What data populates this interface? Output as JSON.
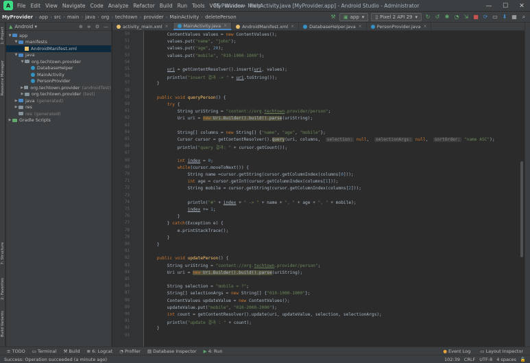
{
  "menu": [
    "File",
    "Edit",
    "View",
    "Navigate",
    "Code",
    "Analyze",
    "Refactor",
    "Build",
    "Run",
    "Tools",
    "VCS",
    "Window",
    "Help"
  ],
  "window_title": "MyProvider - MainActivity.java [MyProvider.app] - Android Studio - Administrator",
  "breadcrumb": [
    "MyProvider",
    "app",
    "src",
    "main",
    "java",
    "org",
    "techtown",
    "provider",
    "MainActivity",
    "deletePerson"
  ],
  "run_config": "app",
  "device": "Pixel 2 API 29",
  "project_view": "Android",
  "left_tools": [
    "1: Project",
    "Resource Manager",
    "7: Structure",
    "2: Favorites",
    "Build Variants"
  ],
  "tree": [
    {
      "label": "app",
      "indent": 0,
      "type": "folder-blue",
      "arrow": "▼"
    },
    {
      "label": "manifests",
      "indent": 1,
      "type": "folder-blue",
      "arrow": "▼"
    },
    {
      "label": "AndroidManifest.xml",
      "indent": 2,
      "type": "xml",
      "arrow": "",
      "selected": true
    },
    {
      "label": "java",
      "indent": 1,
      "type": "folder-blue",
      "arrow": "▼"
    },
    {
      "label": "org.techtown.provider",
      "indent": 2,
      "type": "folder",
      "arrow": "▼"
    },
    {
      "label": "DatabaseHelper",
      "indent": 3,
      "type": "class",
      "arrow": ""
    },
    {
      "label": "MainActivity",
      "indent": 3,
      "type": "class",
      "arrow": ""
    },
    {
      "label": "PersonProvider",
      "indent": 3,
      "type": "class",
      "arrow": ""
    },
    {
      "label": "org.techtown.provider",
      "suffix": "(androidTest)",
      "indent": 2,
      "type": "folder",
      "arrow": "▶"
    },
    {
      "label": "org.techtown.provider",
      "suffix": "(test)",
      "indent": 2,
      "type": "folder",
      "arrow": "▶"
    },
    {
      "label": "java",
      "suffix": "(generated)",
      "indent": 1,
      "type": "folder-blue",
      "arrow": "▶"
    },
    {
      "label": "res",
      "indent": 1,
      "type": "folder",
      "arrow": "▶"
    },
    {
      "label": "res",
      "suffix": "(generated)",
      "indent": 1,
      "type": "folder",
      "arrow": ""
    },
    {
      "label": "Gradle Scripts",
      "indent": 0,
      "type": "folder-green",
      "arrow": "▶"
    }
  ],
  "tabs": [
    {
      "label": "activity_main.xml",
      "color": "#e8bf6a",
      "active": false
    },
    {
      "label": "MainActivity.java",
      "color": "#3592c4",
      "active": true
    },
    {
      "label": "AndroidManifest.xml",
      "color": "#e8bf6a",
      "active": false
    },
    {
      "label": "DatabaseHelper.java",
      "color": "#3592c4",
      "active": false
    },
    {
      "label": "PersonProvider.java",
      "color": "#3592c4",
      "active": false
    }
  ],
  "code_lines": [
    {
      "n": "50",
      "html": "        ContentValues values = <span class='kw'>new</span> ContentValues();"
    },
    {
      "n": "51",
      "html": "        values.put(<span class='str'>\"name\"</span>, <span class='str'>\"john\"</span>);"
    },
    {
      "n": "52",
      "html": "        values.put(<span class='str'>\"age\"</span>, <span class='num'>20</span>);"
    },
    {
      "n": "53",
      "html": "        values.put(<span class='str'>\"mobile\"</span>, <span class='str'>\"010-1000-1000\"</span>);"
    },
    {
      "n": "54",
      "html": ""
    },
    {
      "n": "55",
      "html": "        <span class='ul'>uri</span> = getContentResolver().insert(<span class='ul'>uri</span>, values);"
    },
    {
      "n": "56",
      "html": "        println(<span class='str'>\"insert 결과 -> \"</span> + <span class='ul'>uri</span>.toString());"
    },
    {
      "n": "57",
      "html": "    }"
    },
    {
      "n": "58",
      "html": ""
    },
    {
      "n": "59",
      "html": "    <span class='kw'>public void</span> <span class='fn'>queryPerson</span>() {"
    },
    {
      "n": "60",
      "html": "        <span class='kw'>try</span> {"
    },
    {
      "n": "61",
      "html": "            String uriString = <span class='str'>\"content://org.<span class='ul'>techtown</span>.provider/person\"</span>;"
    },
    {
      "n": "62",
      "html": "            Uri uri = <span class='hl'><span class='kw'>new</span> Uri.Builder().build().parse</span>(uriString);"
    },
    {
      "n": "63",
      "html": ""
    },
    {
      "n": "64",
      "html": "            String[] columns = <span class='kw'>new</span> String[] {<span class='str'>\"name\"</span>, <span class='str'>\"age\"</span>, <span class='str'>\"mobile\"</span>};"
    },
    {
      "n": "65",
      "html": "            Cursor cursor = getContentResolver().<span class='hl'>query</span>(uri, columns,  <span class='hint'>selection:</span> <span class='kw'>null</span>,  <span class='hint'>selectionArgs:</span> <span class='kw'>null</span>,  <span class='hint'>sortOrder:</span> <span class='str'>\"name ASC\"</span>);"
    },
    {
      "n": "66",
      "html": "            println(<span class='str'>\"query 결과: \"</span> + cursor.getCount());"
    },
    {
      "n": "67",
      "html": ""
    },
    {
      "n": "68",
      "html": "            <span class='kw'>int</span> <span class='ul'>index</span> = <span class='num'>0</span>;"
    },
    {
      "n": "69",
      "html": "            <span class='kw'>while</span>(cursor.moveToNext()) {"
    },
    {
      "n": "70",
      "html": "                String name =cursor.getString(cursor.getColumnIndex(columns[<span class='num'>0</span>]));"
    },
    {
      "n": "71",
      "html": "                <span class='kw'>int</span> age = cursor.getInt(cursor.getColumnIndex(columns[<span class='num'>1</span>]));"
    },
    {
      "n": "72",
      "html": "                String mobile = cursor.getString(cursor.getColumnIndex(columns[<span class='num'>2</span>]));"
    },
    {
      "n": "73",
      "html": ""
    },
    {
      "n": "74",
      "html": "                println(<span class='str'>\"#\"</span> + <span class='ul'>index</span> + <span class='str'>\" -> \"</span> + name + <span class='str'>\", \"</span> + age + <span class='str'>\", \"</span> + mobile);"
    },
    {
      "n": "75",
      "html": "                <span class='ul'>index</span> += <span class='num'>1</span>;"
    },
    {
      "n": "76",
      "html": "            }"
    },
    {
      "n": "77",
      "html": "        } <span class='kw'>catch</span>(Exception e) {"
    },
    {
      "n": "78",
      "html": "            e.printStackTrace();"
    },
    {
      "n": "79",
      "html": "        }"
    },
    {
      "n": "80",
      "html": "    }"
    },
    {
      "n": "81",
      "html": ""
    },
    {
      "n": "82",
      "html": "    <span class='kw'>public void</span> <span class='fn'>updatePerson</span>() {"
    },
    {
      "n": "83",
      "html": "        String uriString = <span class='str'>\"content://org.<span class='ul'>techtown</span>.provider/person\"</span>;"
    },
    {
      "n": "84",
      "html": "        Uri uri = <span class='hl'><span class='kw'>new</span> Uri.Builder().build().parse</span>(uriString);"
    },
    {
      "n": "85",
      "html": ""
    },
    {
      "n": "86",
      "html": "        String selection = <span class='str'>\"mobile = ?\"</span>;"
    },
    {
      "n": "87",
      "html": "        String[] selectionArgs = <span class='kw'>new</span> String[] {<span class='str'>\"010-1000-1000\"</span>};"
    },
    {
      "n": "88",
      "html": "        ContentValues updateValue = <span class='kw'>new</span> ContentValues();"
    },
    {
      "n": "89",
      "html": "        updateValue.put(<span class='str'>\"mobile\"</span>, <span class='str'>\"010-2000-2000\"</span>);"
    },
    {
      "n": "90",
      "html": "        <span class='kw'>int</span> count = getContentResolver().update(uri, updateValue, selection, selectionArgs);"
    },
    {
      "n": "91",
      "html": "        println(<span class='str'>\"update 결과 : \"</span> + count);"
    },
    {
      "n": "92",
      "html": "    }"
    },
    {
      "n": "93",
      "html": ""
    }
  ],
  "bottom_tools": [
    "TODO",
    "Terminal",
    "Build",
    "6: Logcat",
    "Profiler",
    "Database Inspector",
    "4: Run"
  ],
  "bottom_right_tools": [
    "Event Log",
    "Layout Inspector"
  ],
  "status_message": "Success: Operation succeeded (a minute ago)",
  "status_right": [
    "102:39",
    "CRLF",
    "UTF-8",
    "4 spaces"
  ]
}
